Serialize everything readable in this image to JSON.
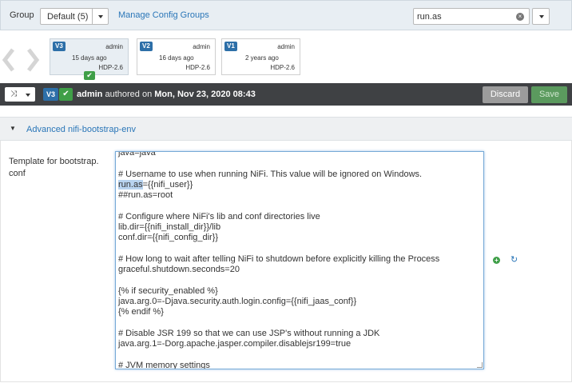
{
  "group_bar": {
    "label": "Group",
    "selected_group": "Default (5)",
    "manage_link": "Manage Config Groups",
    "search_value": "run.as",
    "clear_icon": "times-circle-icon"
  },
  "versions": [
    {
      "badge": "V3",
      "user": "admin",
      "ago": "15 days ago",
      "stack": "HDP-2.6",
      "active": true
    },
    {
      "badge": "V2",
      "user": "admin",
      "ago": "16 days ago",
      "stack": "HDP-2.6",
      "active": false
    },
    {
      "badge": "V1",
      "user": "admin",
      "ago": "2 years ago",
      "stack": "HDP-2.6",
      "active": false
    }
  ],
  "toolbar": {
    "compare_glyph": "⤨",
    "version_badge": "V3",
    "author": "admin",
    "authored_text": "authored on",
    "date": "Mon, Nov 23, 2020 08:43",
    "discard_label": "Discard",
    "save_label": "Save"
  },
  "section": {
    "title": "Advanced nifi-bootstrap-env",
    "field_label": "Template for bootstrap. conf",
    "editor_lines": [
      "java=java",
      "",
      "# Username to use when running NiFi. This value will be ignored on Windows.",
      "run.as={{nifi_user}}",
      "##run.as=root",
      "",
      "# Configure where NiFi's lib and conf directories live",
      "lib.dir={{nifi_install_dir}}/lib",
      "conf.dir={{nifi_config_dir}}",
      "",
      "# How long to wait after telling NiFi to shutdown before explicitly killing the Process",
      "graceful.shutdown.seconds=20",
      "",
      "{% if security_enabled %}",
      "java.arg.0=-Djava.security.auth.login.config={{nifi_jaas_conf}}",
      "{% endif %}",
      "",
      "# Disable JSR 199 so that we can use JSP's without running a JDK",
      "java.arg.1=-Dorg.apache.jasper.compiler.disablejsr199=true",
      "",
      "# JVM memory settings"
    ]
  }
}
